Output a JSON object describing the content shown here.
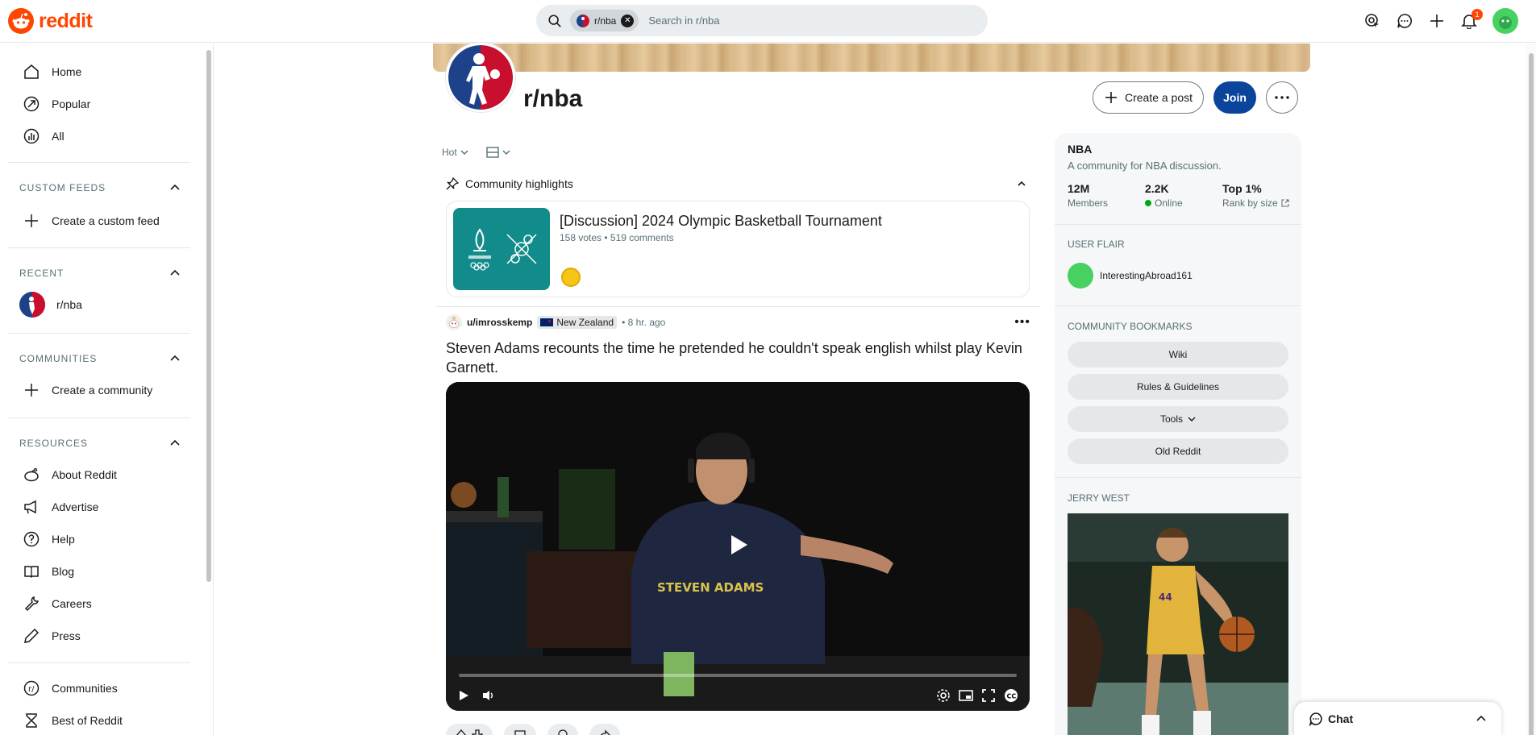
{
  "header": {
    "logo_text": "reddit",
    "search_chip": "r/nba",
    "search_placeholder": "Search in r/nba",
    "notification_count": "1"
  },
  "sidebar": {
    "nav": [
      {
        "label": "Home",
        "icon": "home-icon"
      },
      {
        "label": "Popular",
        "icon": "popular-icon"
      },
      {
        "label": "All",
        "icon": "all-icon"
      }
    ],
    "custom_feeds": {
      "title": "CUSTOM FEEDS",
      "create": "Create a custom feed"
    },
    "recent": {
      "title": "RECENT",
      "items": [
        "r/nba"
      ]
    },
    "communities": {
      "title": "COMMUNITIES",
      "create": "Create a community"
    },
    "resources": {
      "title": "RESOURCES",
      "items": [
        "About Reddit",
        "Advertise",
        "Help",
        "Blog",
        "Careers",
        "Press"
      ]
    },
    "bottom": [
      "Communities",
      "Best of Reddit"
    ]
  },
  "community": {
    "title": "r/nba",
    "create_post": "Create a post",
    "join": "Join"
  },
  "sort": {
    "label": "Hot"
  },
  "highlights": {
    "title": "Community highlights",
    "card_title": "[Discussion] 2024 Olympic Basketball Tournament",
    "card_meta": "158 votes • 519 comments"
  },
  "post": {
    "author": "u/imrosskemp",
    "flair": "New Zealand",
    "time": "• 8 hr. ago",
    "title": "Steven Adams recounts the time he pretended he couldn't speak english whilst play Kevin Garnett.",
    "shirt_text": "STEVEN ADAMS"
  },
  "about": {
    "name": "NBA",
    "description": "A community for NBA discussion.",
    "stats": [
      {
        "value": "12M",
        "label": "Members"
      },
      {
        "value": "2.2K",
        "label": "Online"
      },
      {
        "value": "Top 1%",
        "label": "Rank by size"
      }
    ],
    "user_flair_title": "USER FLAIR",
    "user_flair_name": "InterestingAbroad161",
    "bookmarks_title": "COMMUNITY BOOKMARKS",
    "bookmarks": [
      "Wiki",
      "Rules & Guidelines",
      "Tools",
      "Old Reddit"
    ],
    "widget_title": "JERRY WEST"
  },
  "chat": {
    "label": "Chat"
  },
  "colors": {
    "brand": "#ff4500",
    "join": "#0a449b",
    "online": "#01a816"
  }
}
